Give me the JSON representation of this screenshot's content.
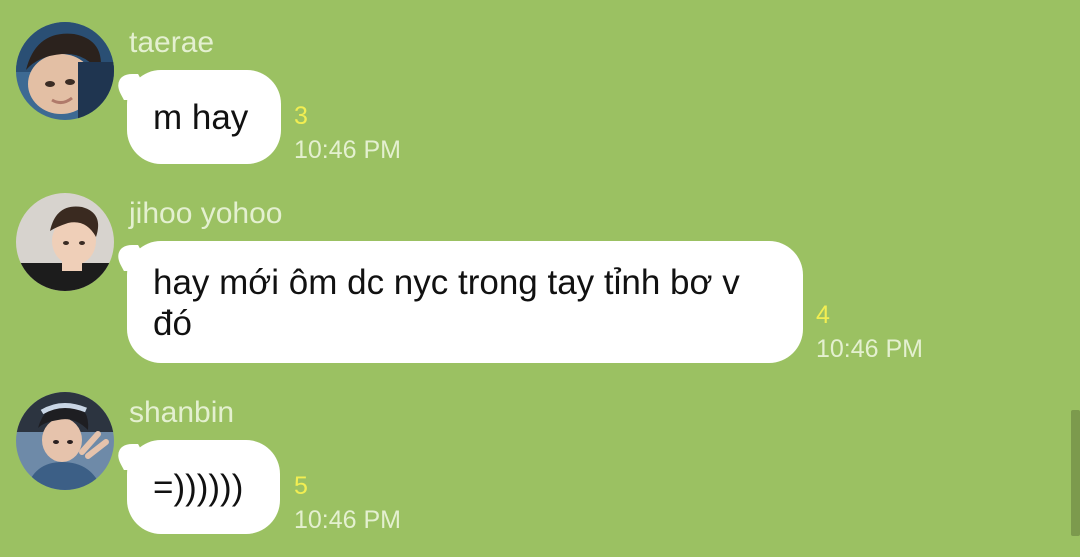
{
  "messages": [
    {
      "sender": "taerae",
      "text": "m hay",
      "unread": "3",
      "time": "10:46 PM"
    },
    {
      "sender": "jihoo yohoo",
      "text": "hay mới ôm dc nyc trong tay tỉnh bơ v đó",
      "unread": "4",
      "time": "10:46 PM"
    },
    {
      "sender": "shanbin",
      "text": "=))))))",
      "unread": "5",
      "time": "10:46 PM"
    }
  ],
  "colors": {
    "background": "#9bc162",
    "bubble": "#ffffff",
    "unread": "#f2ee52",
    "meta_text": "#e4f0d0"
  }
}
